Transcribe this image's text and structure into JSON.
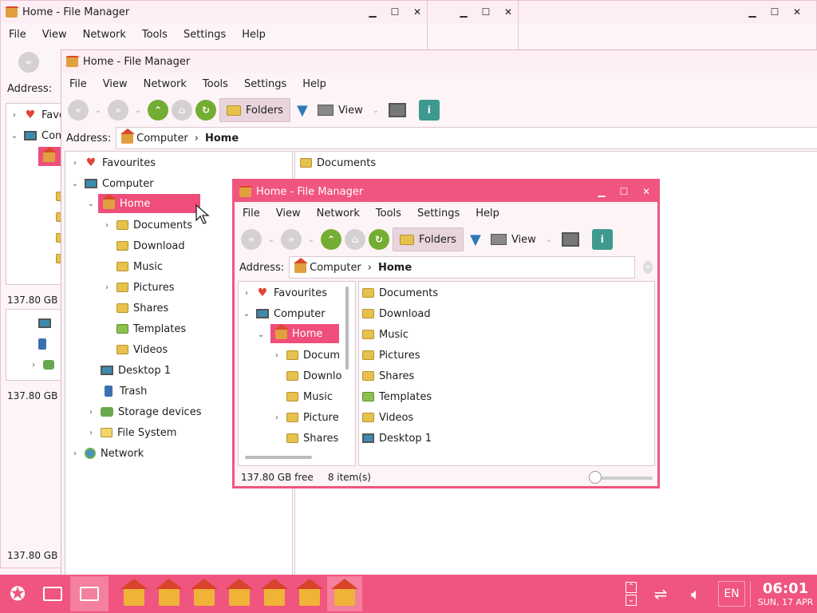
{
  "back_window": {
    "title": "Home - File Manager",
    "menu": [
      "File",
      "View",
      "Network",
      "Tools",
      "Settings",
      "Help"
    ],
    "address_label": "Address:",
    "tree_items": [
      "Favo",
      "Com"
    ],
    "status": [
      "137.80 GB f",
      "137.80 GB f",
      "137.80 GB f"
    ]
  },
  "mid_window": {
    "title": "Home - File Manager",
    "menu": [
      "File",
      "View",
      "Network",
      "Tools",
      "Settings",
      "Help"
    ],
    "toolbar": {
      "folders_label": "Folders",
      "view_label": "View"
    },
    "address_label": "Address:",
    "breadcrumb": [
      "Computer",
      "Home"
    ],
    "tree": [
      {
        "label": "Favourites",
        "icon": "heart-icon",
        "level": 0,
        "arrow": ">"
      },
      {
        "label": "Computer",
        "icon": "computer-icon",
        "level": 0,
        "arrow": "v"
      },
      {
        "label": "Home",
        "icon": "home-icon",
        "level": 1,
        "arrow": "v",
        "selected": true
      },
      {
        "label": "Documents",
        "icon": "folder-icon",
        "level": 2,
        "arrow": ">"
      },
      {
        "label": "Download",
        "icon": "folder-icon",
        "level": 2,
        "arrow": ""
      },
      {
        "label": "Music",
        "icon": "folder-icon",
        "level": 2,
        "arrow": ""
      },
      {
        "label": "Pictures",
        "icon": "folder-icon",
        "level": 2,
        "arrow": ">"
      },
      {
        "label": "Shares",
        "icon": "folder-icon",
        "level": 2,
        "arrow": ""
      },
      {
        "label": "Templates",
        "icon": "folder-icon",
        "level": 2,
        "arrow": ""
      },
      {
        "label": "Videos",
        "icon": "folder-icon",
        "level": 2,
        "arrow": ""
      },
      {
        "label": "Desktop 1",
        "icon": "desktop-icon",
        "level": 1,
        "arrow": ""
      },
      {
        "label": "Trash",
        "icon": "trash-icon",
        "level": 1,
        "arrow": ""
      },
      {
        "label": "Storage devices",
        "icon": "storage-icon",
        "level": 1,
        "arrow": ">"
      },
      {
        "label": "File System",
        "icon": "folder-icon",
        "level": 1,
        "arrow": ">"
      },
      {
        "label": "Network",
        "icon": "network-icon",
        "level": 0,
        "arrow": ">"
      }
    ],
    "files": [
      "Documents"
    ]
  },
  "front_window": {
    "title": "Home - File Manager",
    "menu": [
      "File",
      "View",
      "Network",
      "Tools",
      "Settings",
      "Help"
    ],
    "toolbar": {
      "folders_label": "Folders",
      "view_label": "View"
    },
    "address_label": "Address:",
    "breadcrumb": [
      "Computer",
      "Home"
    ],
    "tree": [
      {
        "label": "Favourites",
        "icon": "heart-icon",
        "level": 0,
        "arrow": ">"
      },
      {
        "label": "Computer",
        "icon": "computer-icon",
        "level": 0,
        "arrow": "v"
      },
      {
        "label": "Home",
        "icon": "home-icon",
        "level": 1,
        "arrow": "v",
        "selected": true
      },
      {
        "label": "Docum",
        "icon": "folder-icon",
        "level": 2,
        "arrow": ">"
      },
      {
        "label": "Downlo",
        "icon": "folder-icon",
        "level": 2,
        "arrow": ""
      },
      {
        "label": "Music",
        "icon": "folder-icon",
        "level": 2,
        "arrow": ""
      },
      {
        "label": "Picture",
        "icon": "folder-icon",
        "level": 2,
        "arrow": ">"
      },
      {
        "label": "Shares",
        "icon": "folder-icon",
        "level": 2,
        "arrow": ""
      }
    ],
    "files": [
      "Documents",
      "Download",
      "Music",
      "Pictures",
      "Shares",
      "Templates",
      "Videos",
      "Desktop 1"
    ],
    "status": {
      "free": "137.80 GB free",
      "items": "8 item(s)"
    }
  },
  "taskbar": {
    "app_count": 7,
    "lang": "EN",
    "time": "06:01",
    "date": "SUN, 17 APR"
  },
  "colors": {
    "accent": "#f0557f",
    "selected": "#f04e7a"
  }
}
